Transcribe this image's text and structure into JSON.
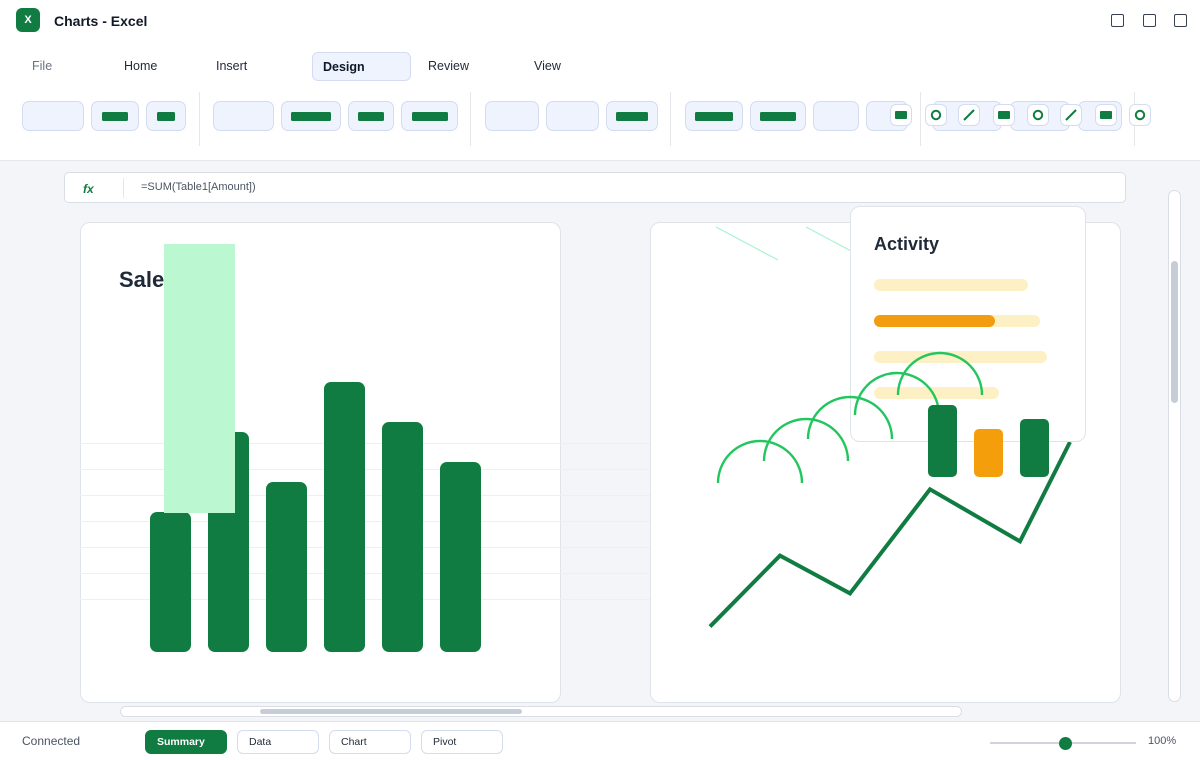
{
  "window": {
    "title": "Charts - Excel",
    "app_icon": "X"
  },
  "ribbon": {
    "tabs": [
      {
        "label": "File"
      },
      {
        "label": "Home"
      },
      {
        "label": "Insert"
      },
      {
        "label": "Design",
        "active": true
      },
      {
        "label": "Review"
      },
      {
        "label": "View"
      }
    ]
  },
  "formula_bar": {
    "fx_label": "fx",
    "formula": "=SUM(Table1[Amount])"
  },
  "sales_chart": {
    "title_visible_fragment": "Sale",
    "chart_data": {
      "type": "bar",
      "values": [
        140,
        220,
        170,
        270,
        230,
        190
      ],
      "ylim": [
        0,
        300
      ],
      "bar_color": "#107c41",
      "highlight_color": "#bbf7d0"
    }
  },
  "trend_chart": {
    "chart_data": {
      "type": "line",
      "values": [
        10,
        85,
        45,
        155,
        100,
        205
      ],
      "line_color": "#107c41",
      "arc_color": "#22c55e"
    },
    "mini_bars": [
      {
        "value": 72,
        "color": "#107c41"
      },
      {
        "value": 48,
        "color": "#f59e0b"
      },
      {
        "value": 58,
        "color": "#107c41"
      }
    ]
  },
  "activity_popup": {
    "title": "Activity",
    "progress": [
      {
        "fill": 0.0
      },
      {
        "fill": 0.73
      },
      {
        "fill": 0.0
      },
      {
        "fill": 0.0
      }
    ]
  },
  "status_bar": {
    "status": "Connected",
    "sheet_tabs": [
      {
        "label": "Summary",
        "active": true
      },
      {
        "label": "Data"
      },
      {
        "label": "Chart"
      },
      {
        "label": "Pivot"
      }
    ],
    "zoom": "100%"
  },
  "colors": {
    "accent": "#107c41",
    "warning": "#f29c11"
  }
}
